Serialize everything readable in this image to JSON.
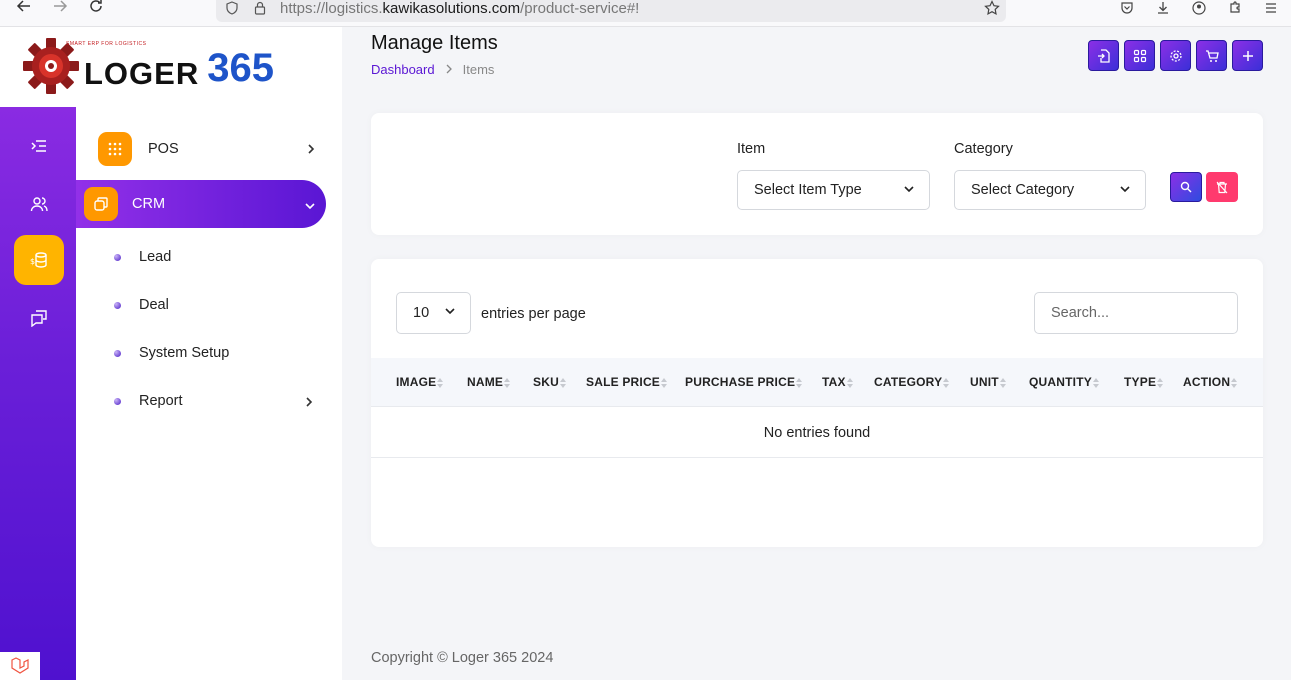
{
  "browser": {
    "url_prefix": "https://logistics.",
    "url_host": "kawikasolutions.com",
    "url_path": "/product-service#!"
  },
  "logo": {
    "tagline": "SMART ERP FOR LOGISTICS",
    "word": "LOGER",
    "number": "365"
  },
  "sidebar": {
    "menu": [
      {
        "label": "POS"
      },
      {
        "label": "CRM"
      }
    ],
    "submenu": [
      {
        "label": "Lead"
      },
      {
        "label": "Deal"
      },
      {
        "label": "System Setup"
      },
      {
        "label": "Report"
      }
    ]
  },
  "header": {
    "title": "Manage Items",
    "breadcrumb": {
      "home": "Dashboard",
      "current": "Items"
    }
  },
  "filters": {
    "item_label": "Item",
    "item_selected": "Select Item Type",
    "category_label": "Category",
    "category_selected": "Select Category"
  },
  "table": {
    "per_page_value": "10",
    "per_page_label": "entries per page",
    "search_placeholder": "Search...",
    "columns": [
      "IMAGE",
      "NAME",
      "SKU",
      "SALE PRICE",
      "PURCHASE PRICE",
      "TAX",
      "CATEGORY",
      "UNIT",
      "QUANTITY",
      "TYPE",
      "ACTION"
    ],
    "empty_message": "No entries found"
  },
  "footer": {
    "copyright": "Copyright © Loger 365 2024"
  },
  "colors": {
    "accent_purple": "#5a16d4",
    "accent_orange": "#ff9800",
    "active_rail": "#ffb400",
    "reset_red": "#ff3a6e",
    "logo_blue": "#1e54c9"
  }
}
